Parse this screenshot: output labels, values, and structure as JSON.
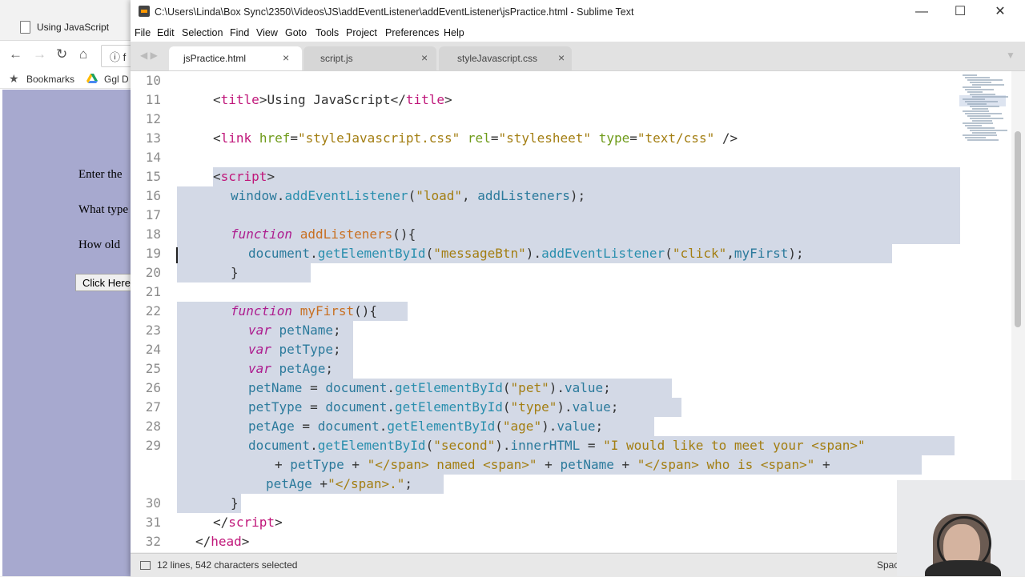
{
  "browser": {
    "tab_title": "Using JavaScript",
    "omni_text": "f",
    "bookmarks_label": "Bookmarks",
    "bookmark_ggl": "Ggl D",
    "page_lines": [
      "Enter the",
      "What type",
      "How old"
    ],
    "page_button": "Click Here"
  },
  "sublime": {
    "window_title": "C:\\Users\\Linda\\Box Sync\\2350\\Videos\\JS\\addEventListener\\addEventListener\\jsPractice.html - Sublime Text",
    "menu": [
      "File",
      "Edit",
      "Selection",
      "Find",
      "View",
      "Goto",
      "Tools",
      "Project",
      "Preferences",
      "Help"
    ],
    "tabs": [
      {
        "label": "jsPractice.html",
        "active": true
      },
      {
        "label": "script.js",
        "active": false
      },
      {
        "label": "styleJavascript.css",
        "active": false
      }
    ],
    "line_numbers": [
      "10",
      "11",
      "12",
      "13",
      "14",
      "15",
      "16",
      "17",
      "18",
      "19",
      "20",
      "21",
      "22",
      "23",
      "24",
      "25",
      "26",
      "27",
      "28",
      "29",
      "30",
      "31",
      "32"
    ],
    "status_text": "12 lines, 542 characters selected",
    "status_right": "Spac"
  },
  "colors": {
    "selection": "#d3d9e6",
    "tag": "#c0177a",
    "attribute": "#6f9b1a",
    "string": "#a37e12",
    "keyword": "#ad1d8f",
    "function_name": "#c87022",
    "object": "#2b7a9c"
  },
  "icons": [
    "page-icon",
    "back-icon",
    "forward-icon",
    "reload-icon",
    "home-icon",
    "info-icon",
    "star-icon",
    "drive-icon",
    "minimize-icon",
    "maximize-icon",
    "close-icon",
    "tab-close-icon",
    "status-panel-icon"
  ]
}
